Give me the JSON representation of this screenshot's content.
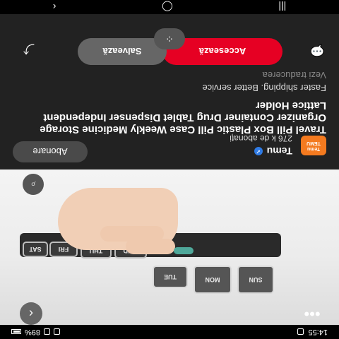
{
  "status_bar": {
    "time": "14:55",
    "battery": "89%"
  },
  "product": {
    "image_icons": {
      "more": "more-icon",
      "back": "chevron-left-icon",
      "lens": "visual-search-icon"
    },
    "case_labels": [
      "SUN",
      "MON",
      "TUE",
      "WED",
      "THU",
      "FRI",
      "SAT"
    ]
  },
  "creator": {
    "logo_line1": "Temu",
    "logo_line2": "TEMU",
    "name": "Temu",
    "followers": "276 k de abonați",
    "subscribe_label": "Abonare"
  },
  "pin": {
    "title": "Travel Pill Box Plastic Pill Case Weekly Medicine Storage Organizer Container Drug Tablet Dispenser Independent Lattice Holder",
    "subtitle": "Faster shipping. Better service",
    "translate_label": "Vezi traducerea"
  },
  "actions": {
    "visit_label": "Accesează",
    "save_label": "Salvează",
    "accent": "#e60023"
  }
}
